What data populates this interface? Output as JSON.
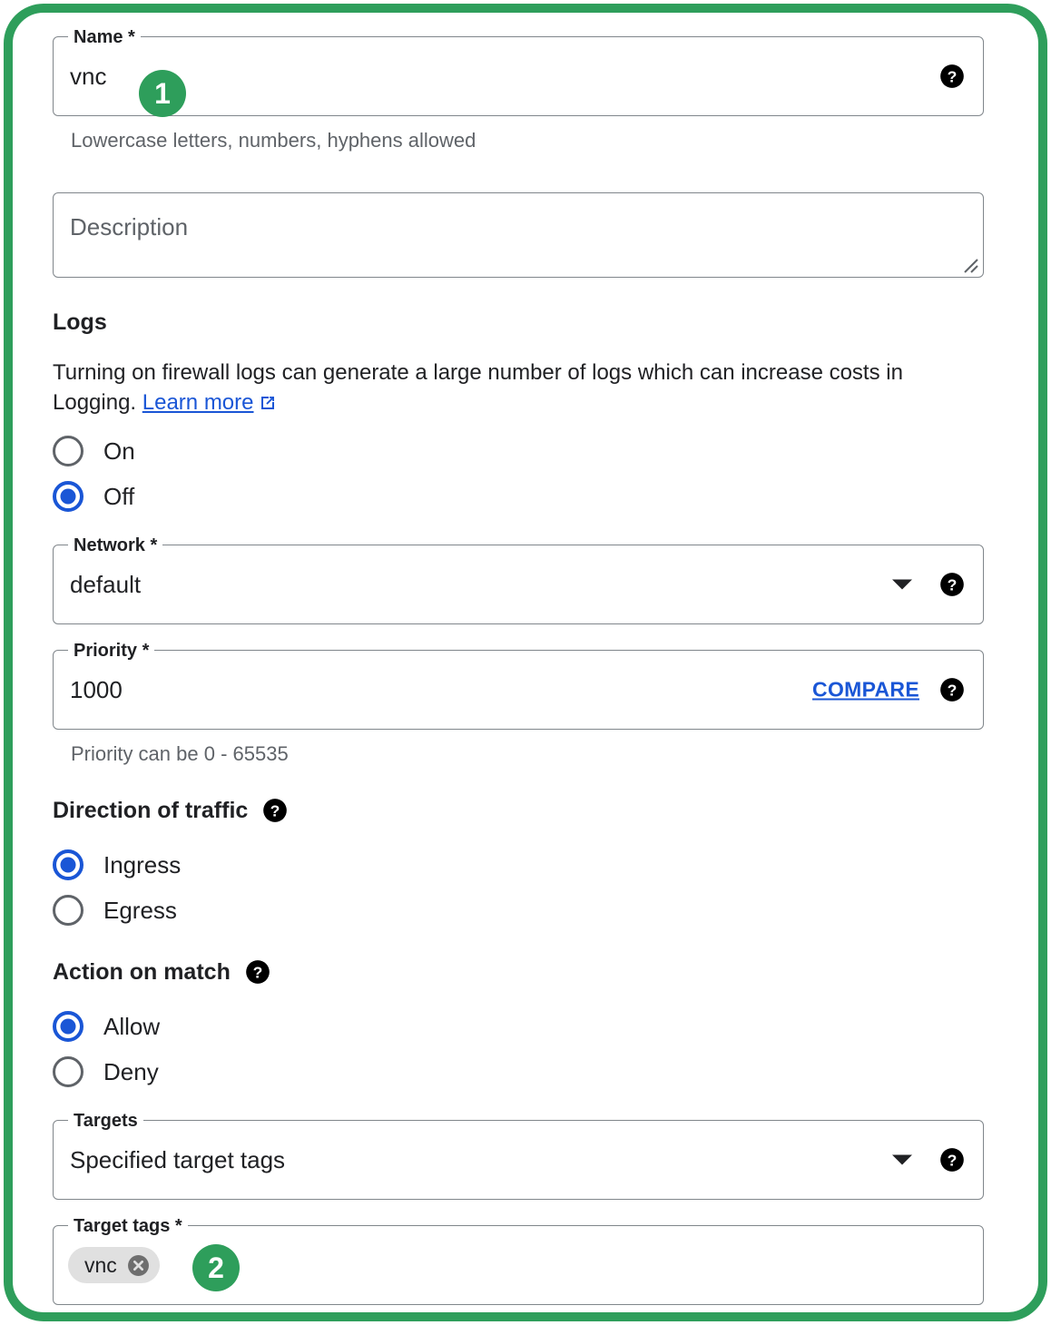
{
  "frame": {
    "accent_color": "#2e9e5b"
  },
  "annotations": [
    {
      "number": "1"
    },
    {
      "number": "2"
    }
  ],
  "form": {
    "name": {
      "label": "Name *",
      "value": "vnc",
      "hint": "Lowercase letters, numbers, hyphens allowed",
      "help_icon": "help-icon"
    },
    "description": {
      "placeholder": "Description",
      "resize_icon": "resize-grip-icon"
    },
    "logs": {
      "heading": "Logs",
      "description_before_link": " Turning on firewall logs can generate a large number of logs which can increase costs in Logging. ",
      "link_label": "Learn more",
      "link_icon": "external-link-icon",
      "options": [
        {
          "label": "On",
          "selected": false
        },
        {
          "label": "Off",
          "selected": true
        }
      ]
    },
    "network": {
      "label": "Network *",
      "value": "default",
      "caret_icon": "chevron-down-icon",
      "help_icon": "help-icon"
    },
    "priority": {
      "label": "Priority *",
      "value": "1000",
      "compare_label": "COMPARE",
      "hint": "Priority can be 0 - 65535",
      "help_icon": "help-icon"
    },
    "direction": {
      "heading": "Direction of traffic",
      "help_icon": "help-icon",
      "options": [
        {
          "label": "Ingress",
          "selected": true
        },
        {
          "label": "Egress",
          "selected": false
        }
      ]
    },
    "action": {
      "heading": "Action on match",
      "help_icon": "help-icon",
      "options": [
        {
          "label": "Allow",
          "selected": true
        },
        {
          "label": "Deny",
          "selected": false
        }
      ]
    },
    "targets": {
      "label": "Targets",
      "value": "Specified target tags",
      "caret_icon": "chevron-down-icon",
      "help_icon": "help-icon"
    },
    "target_tags": {
      "label": "Target tags *",
      "chips": [
        {
          "label": "vnc",
          "remove_icon": "chip-remove-icon"
        }
      ]
    }
  },
  "colors": {
    "accent_green": "#2e9e5b",
    "link_blue": "#1a56d6",
    "radio_selected": "#1a56d6",
    "field_border": "#80868b",
    "hint_text": "#5f6368"
  }
}
